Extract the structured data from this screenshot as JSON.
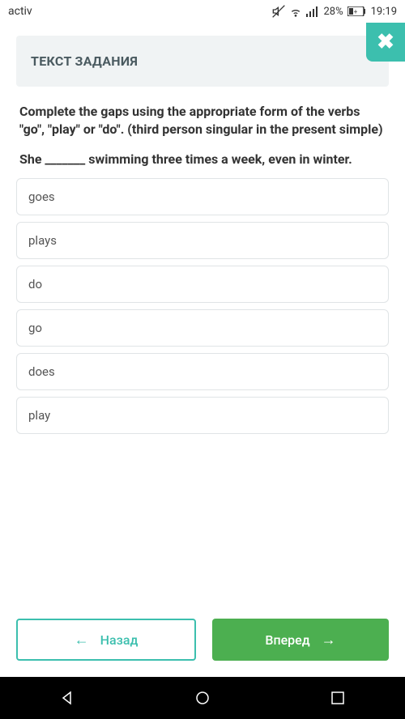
{
  "status_bar": {
    "carrier": "activ",
    "battery": "28%",
    "time": "19:19"
  },
  "task": {
    "header": "ТЕКСТ ЗАДАНИЯ",
    "instruction": "Complete the gaps using the appropriate form of the verbs \"go\", \"play\" or \"do\". (third person singular in the present simple)",
    "question": "She _______ swimming three times a week, even in winter."
  },
  "options": [
    "goes",
    "plays",
    "do",
    "go",
    "does",
    "play"
  ],
  "nav": {
    "back": "Назад",
    "forward": "Вперед"
  }
}
